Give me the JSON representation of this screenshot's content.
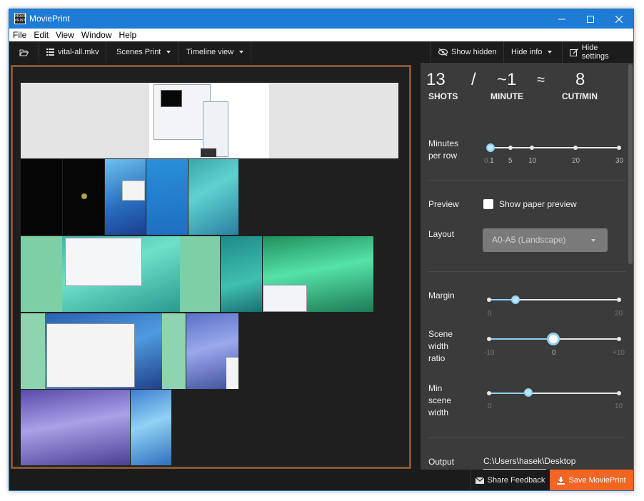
{
  "window": {
    "title": "MoviePrint",
    "logo_text": "MOVIE PRINT"
  },
  "menu": [
    "File",
    "Edit",
    "View",
    "Window",
    "Help"
  ],
  "toolbar": {
    "file_name": "vital-all.mkv",
    "scenes_print": "Scenes Print",
    "timeline_view": "Timeline view",
    "show_hidden": "Show hidden",
    "hide_info": "Hide info",
    "hide_settings": "Hide settings"
  },
  "stats": {
    "shots_value": "13",
    "shots_label": "SHOTS",
    "slash": "/",
    "minute_value": "~1",
    "minute_label": "MINUTE",
    "approx": "≈",
    "cut_value": "8",
    "cut_label": "CUT/MIN"
  },
  "settings": {
    "minutes_per_row": {
      "label": "Minutes per row",
      "ticks": [
        "0.1",
        "1",
        "5",
        "10",
        "20",
        "30"
      ],
      "selected": "1"
    },
    "preview": {
      "label": "Preview",
      "checkbox_label": "Show paper preview",
      "checked": false
    },
    "layout": {
      "label": "Layout",
      "value": "A0-A5 (Landscape)"
    },
    "margin": {
      "label": "Margin",
      "min": "0",
      "max": "20",
      "value": 3
    },
    "scene_width_ratio": {
      "label": "Scene width ratio",
      "min": "-10",
      "mid": "0",
      "max": "+10",
      "value": 0
    },
    "min_scene_width": {
      "label": "Min scene width",
      "min": "0",
      "max": "10",
      "value": 3
    },
    "output_path": {
      "label": "Output path",
      "value": "C:\\Users\\hasek\\Desktop"
    }
  },
  "footer": {
    "share_feedback": "Share Feedback",
    "save_movieprint": "Save MoviePrint"
  },
  "colors": {
    "accent": "#1e7bd6",
    "save": "#f26522",
    "frame": "#8a5434",
    "slider": "#8fd0f0"
  }
}
